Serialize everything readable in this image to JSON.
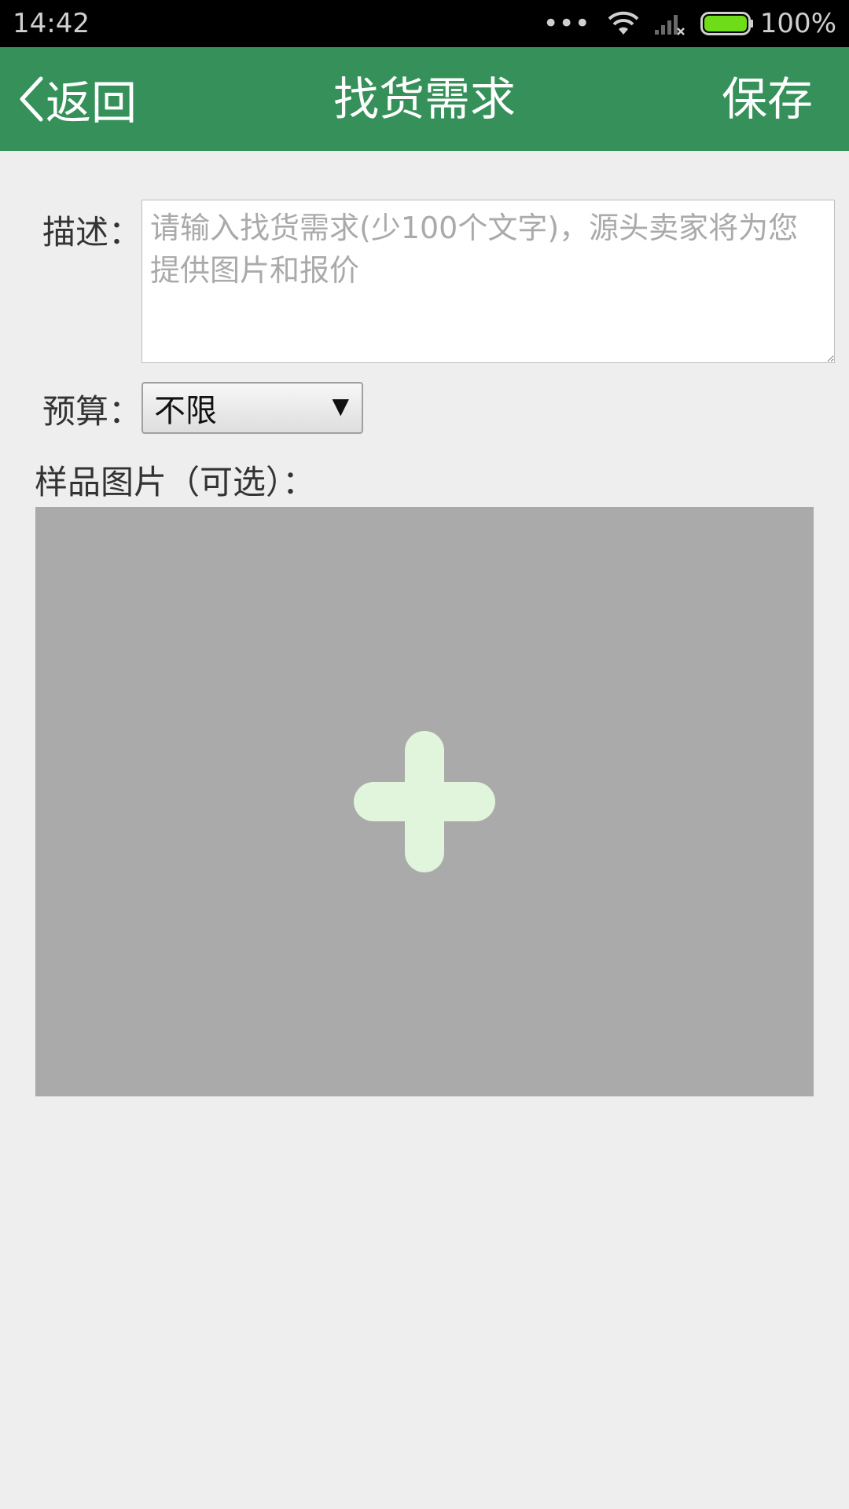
{
  "status_bar": {
    "time": "14:42",
    "dots": "•••",
    "battery": "100%",
    "icons": [
      "wifi-icon",
      "signal-icon",
      "battery-icon"
    ]
  },
  "header": {
    "back_label": "返回",
    "title": "找货需求",
    "save_label": "保存",
    "background_color": "#36905a"
  },
  "form": {
    "description": {
      "label": "描述：",
      "value": "",
      "placeholder": "请输入找货需求(少100个文字)，源头卖家将为您提供图片和报价"
    },
    "budget": {
      "label": "预算：",
      "selected": "不限",
      "arrow": "▼"
    },
    "sample_images": {
      "label": "样品图片（可选）：",
      "icon": "plus-icon"
    }
  }
}
